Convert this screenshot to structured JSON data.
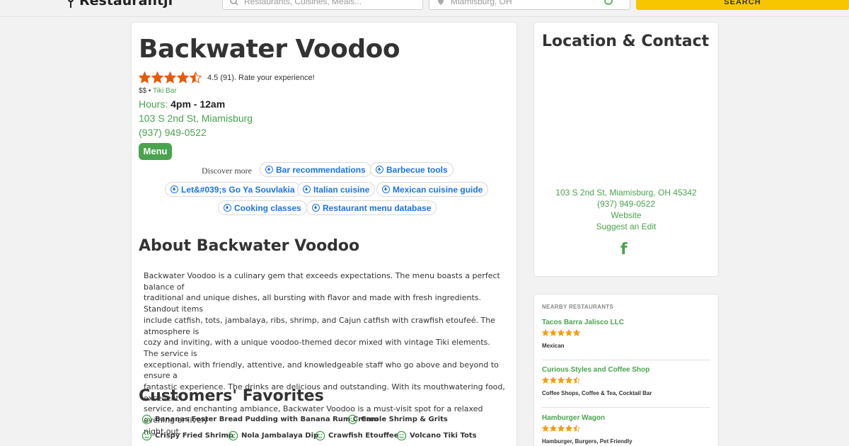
{
  "header": {
    "logo_text": "Restaurantji",
    "search_placeholder": "Restaurants, Cuisines, Meals...",
    "location_value": "Miamisburg, OH",
    "search_button": "SEARCH"
  },
  "restaurant": {
    "name": "Backwater Voodoo",
    "rating_text": "4.5 (91). Rate your experience!",
    "rating": 4.5,
    "price": "$$",
    "category": "Tiki Bar",
    "hours_label": "Hours:",
    "hours_value": "4pm - 12am",
    "address": "103 S 2nd St, Miamisburg",
    "phone": "(937) 949-0522",
    "menu_button": "Menu"
  },
  "discover": {
    "label": "Discover more",
    "chips": [
      "Bar recommendations",
      "Barbecue tools",
      "Let&#039;s Go Ya Souvlakia",
      "Italian cuisine",
      "Mexican cuisine guide",
      "Cooking classes",
      "Restaurant menu database"
    ]
  },
  "about": {
    "heading": "About Backwater Voodoo",
    "lines": [
      "Backwater Voodoo is a culinary gem that exceeds expectations. The menu boasts a perfect balance of",
      "traditional and unique dishes, all bursting with flavor and made with fresh ingredients. Standout items",
      "include catfish, tots, jambalaya, ribs, shrimp, and Cajun catfish with crawfish etoufeé. The atmosphere is",
      "cozy and inviting, with a unique voodoo-themed decor mixed with vintage Tiki elements. The service is",
      "exceptional, with friendly, attentive, and knowledgeable staff who go above and beyond to ensure a",
      "fantastic experience. The drinks are delicious and outstanding. With its mouthwatering food, excellent",
      "service, and enchanting ambiance, Backwater Voodoo is a must-visit spot for a relaxed evening or lively",
      "night out."
    ]
  },
  "favorites": {
    "heading": "Customers' Favorites",
    "items": [
      "Bananas Foster Bread Pudding with Banana Rum Cream",
      "Creole Shrimp & Grits",
      "Crispy Fried Shrimp",
      "Nola Jambalaya Dip",
      "Crawfish Etouffee",
      "Volcano Tiki Tots"
    ]
  },
  "contact": {
    "heading": "Location & Contact",
    "address": "103 S 2nd St, Miamisburg, OH 45342",
    "phone": "(937) 949-0522",
    "website": "Website",
    "suggest": "Suggest an Edit",
    "facebook_icon": "facebook-icon"
  },
  "nearby": {
    "heading": "NEARBY RESTAURANTS",
    "items": [
      {
        "name": "Tacos Barra Jalisco LLC",
        "rating": 5,
        "category": "Mexican"
      },
      {
        "name": "Curious Styles and Coffee Shop",
        "rating": 4.5,
        "category": "Coffee Shops, Coffee & Tea, Cocktail Bar"
      },
      {
        "name": "Hamburger Wagon",
        "rating": 4.5,
        "category": "Hamburger, Burgers, Pet Friendly"
      }
    ]
  },
  "colors": {
    "accent_green": "#4aa34f",
    "star_orange": "#e8590c",
    "nearby_star": "#f39c12",
    "chip_blue": "#1a73e8",
    "search_yellow": "#f7c600"
  }
}
